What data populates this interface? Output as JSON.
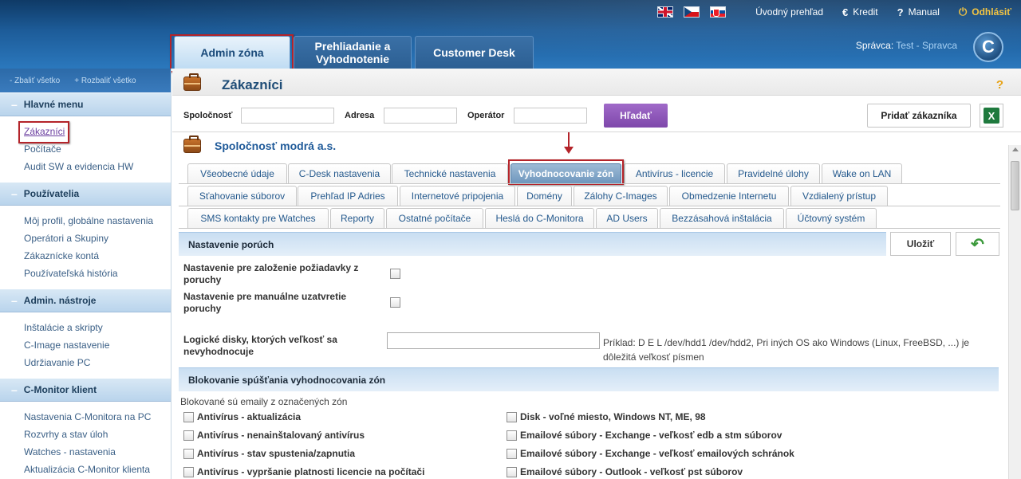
{
  "topnav": {
    "overview": "Úvodný prehľad",
    "credit": "Kredit",
    "manual": "Manual",
    "logout": "Odhlásiť"
  },
  "main_tabs": [
    "Admin zóna",
    "Prehliadanie a Vyhodnotenie",
    "Customer Desk"
  ],
  "supervisor": {
    "label": "Správca: ",
    "name": "Test - Spravca"
  },
  "sidebar": {
    "collapse": "- Zbaliť všetko",
    "expand": "+ Rozbaliť všetko",
    "groups": [
      {
        "title": "Hlavné menu",
        "items": [
          "Zákazníci",
          "Počítače",
          "Audit SW a evidencia HW"
        ]
      },
      {
        "title": "Používatelia",
        "items": [
          "Môj profil, globálne nastavenia",
          "Operátori a Skupiny",
          "Zákaznícke kontá",
          "Používateľská história"
        ]
      },
      {
        "title": "Admin. nástroje",
        "items": [
          "Inštalácie a skripty",
          "C-Image nastavenie",
          "Udržiavanie PC"
        ]
      },
      {
        "title": "C-Monitor klient",
        "items": [
          "Nastavenia C-Monitora na PC",
          "Rozvrhy a stav úloh",
          "Watches - nastavenia",
          "Aktualizácia C-Monitor klienta"
        ]
      }
    ]
  },
  "page": {
    "title": "Zákazníci",
    "help": "?",
    "search": {
      "company_label": "Spoločnosť",
      "address_label": "Adresa",
      "operator_label": "Operátor",
      "search_button": "Hľadať",
      "add_button": "Pridať zákazníka"
    },
    "company_name": "Spoločnosť modrá a.s.",
    "tabs_row1": [
      "Všeobecné údaje",
      "C-Desk nastavenia",
      "Technické nastavenia",
      "Vyhodnocovanie zón",
      "Antivírus - licencie",
      "Pravidelné úlohy",
      "Wake on LAN"
    ],
    "tabs_row2": [
      "Sťahovanie súborov",
      "Prehľad IP Adries",
      "Internetové pripojenia",
      "Domény",
      "Zálohy C-Images",
      "Obmedzenie Internetu",
      "Vzdialený prístup"
    ],
    "tabs_row3": [
      "SMS kontakty pre Watches",
      "Reporty",
      "Ostatné počítače",
      "Heslá do C-Monitora",
      "AD Users",
      "Bezzásahová inštalácia",
      "Účtovný systém"
    ],
    "section1_title": "Nastavenie porúch",
    "save_button": "Uložiť",
    "field1_label": "Nastavenie pre založenie požiadavky z poruchy",
    "field2_label": "Nastavenie pre manuálne uzatvretie poruchy",
    "field3_label": "Logické disky, ktorých veľkosť sa nevyhodnocuje",
    "field3_hint": "Príklad: D E L /dev/hdd1 /dev/hdd2, Pri iných OS ako Windows (Linux, FreeBSD, ...) je dôležitá veľkosť písmen",
    "section2_title": "Blokovanie spúšťania vyhodnocovania zón",
    "blocked_intro": "Blokované sú emaily z označených zón",
    "left_checks": [
      "Antivírus - aktualizácia",
      "Antivírus - nenainštalovaný antivírus",
      "Antivírus - stav spustenia/zapnutia",
      "Antivírus - vypršanie platnosti licencie na počítači"
    ],
    "right_checks": [
      "Disk - voľné miesto, Windows NT, ME, 98",
      "Emailové súbory - Exchange - veľkosť edb a stm súborov",
      "Emailové súbory - Exchange - veľkosť emailových schránok",
      "Emailové súbory - Outlook - veľkosť pst súborov"
    ]
  }
}
